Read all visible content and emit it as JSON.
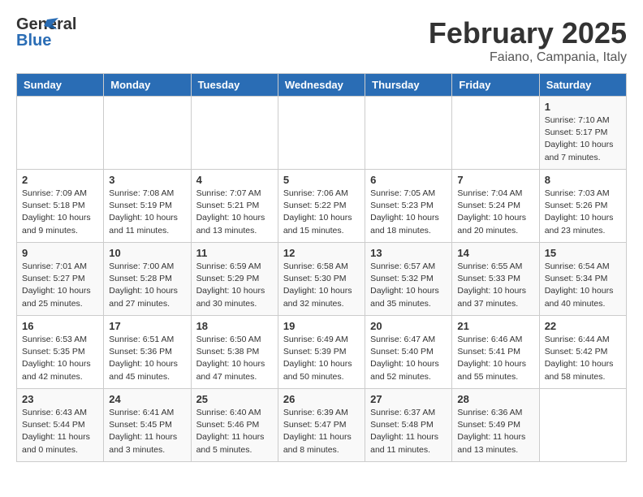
{
  "logo": {
    "line1": "General",
    "line2": "Blue"
  },
  "title": "February 2025",
  "location": "Faiano, Campania, Italy",
  "days_of_week": [
    "Sunday",
    "Monday",
    "Tuesday",
    "Wednesday",
    "Thursday",
    "Friday",
    "Saturday"
  ],
  "weeks": [
    [
      {
        "day": "",
        "info": ""
      },
      {
        "day": "",
        "info": ""
      },
      {
        "day": "",
        "info": ""
      },
      {
        "day": "",
        "info": ""
      },
      {
        "day": "",
        "info": ""
      },
      {
        "day": "",
        "info": ""
      },
      {
        "day": "1",
        "info": "Sunrise: 7:10 AM\nSunset: 5:17 PM\nDaylight: 10 hours\nand 7 minutes."
      }
    ],
    [
      {
        "day": "2",
        "info": "Sunrise: 7:09 AM\nSunset: 5:18 PM\nDaylight: 10 hours\nand 9 minutes."
      },
      {
        "day": "3",
        "info": "Sunrise: 7:08 AM\nSunset: 5:19 PM\nDaylight: 10 hours\nand 11 minutes."
      },
      {
        "day": "4",
        "info": "Sunrise: 7:07 AM\nSunset: 5:21 PM\nDaylight: 10 hours\nand 13 minutes."
      },
      {
        "day": "5",
        "info": "Sunrise: 7:06 AM\nSunset: 5:22 PM\nDaylight: 10 hours\nand 15 minutes."
      },
      {
        "day": "6",
        "info": "Sunrise: 7:05 AM\nSunset: 5:23 PM\nDaylight: 10 hours\nand 18 minutes."
      },
      {
        "day": "7",
        "info": "Sunrise: 7:04 AM\nSunset: 5:24 PM\nDaylight: 10 hours\nand 20 minutes."
      },
      {
        "day": "8",
        "info": "Sunrise: 7:03 AM\nSunset: 5:26 PM\nDaylight: 10 hours\nand 23 minutes."
      }
    ],
    [
      {
        "day": "9",
        "info": "Sunrise: 7:01 AM\nSunset: 5:27 PM\nDaylight: 10 hours\nand 25 minutes."
      },
      {
        "day": "10",
        "info": "Sunrise: 7:00 AM\nSunset: 5:28 PM\nDaylight: 10 hours\nand 27 minutes."
      },
      {
        "day": "11",
        "info": "Sunrise: 6:59 AM\nSunset: 5:29 PM\nDaylight: 10 hours\nand 30 minutes."
      },
      {
        "day": "12",
        "info": "Sunrise: 6:58 AM\nSunset: 5:30 PM\nDaylight: 10 hours\nand 32 minutes."
      },
      {
        "day": "13",
        "info": "Sunrise: 6:57 AM\nSunset: 5:32 PM\nDaylight: 10 hours\nand 35 minutes."
      },
      {
        "day": "14",
        "info": "Sunrise: 6:55 AM\nSunset: 5:33 PM\nDaylight: 10 hours\nand 37 minutes."
      },
      {
        "day": "15",
        "info": "Sunrise: 6:54 AM\nSunset: 5:34 PM\nDaylight: 10 hours\nand 40 minutes."
      }
    ],
    [
      {
        "day": "16",
        "info": "Sunrise: 6:53 AM\nSunset: 5:35 PM\nDaylight: 10 hours\nand 42 minutes."
      },
      {
        "day": "17",
        "info": "Sunrise: 6:51 AM\nSunset: 5:36 PM\nDaylight: 10 hours\nand 45 minutes."
      },
      {
        "day": "18",
        "info": "Sunrise: 6:50 AM\nSunset: 5:38 PM\nDaylight: 10 hours\nand 47 minutes."
      },
      {
        "day": "19",
        "info": "Sunrise: 6:49 AM\nSunset: 5:39 PM\nDaylight: 10 hours\nand 50 minutes."
      },
      {
        "day": "20",
        "info": "Sunrise: 6:47 AM\nSunset: 5:40 PM\nDaylight: 10 hours\nand 52 minutes."
      },
      {
        "day": "21",
        "info": "Sunrise: 6:46 AM\nSunset: 5:41 PM\nDaylight: 10 hours\nand 55 minutes."
      },
      {
        "day": "22",
        "info": "Sunrise: 6:44 AM\nSunset: 5:42 PM\nDaylight: 10 hours\nand 58 minutes."
      }
    ],
    [
      {
        "day": "23",
        "info": "Sunrise: 6:43 AM\nSunset: 5:44 PM\nDaylight: 11 hours\nand 0 minutes."
      },
      {
        "day": "24",
        "info": "Sunrise: 6:41 AM\nSunset: 5:45 PM\nDaylight: 11 hours\nand 3 minutes."
      },
      {
        "day": "25",
        "info": "Sunrise: 6:40 AM\nSunset: 5:46 PM\nDaylight: 11 hours\nand 5 minutes."
      },
      {
        "day": "26",
        "info": "Sunrise: 6:39 AM\nSunset: 5:47 PM\nDaylight: 11 hours\nand 8 minutes."
      },
      {
        "day": "27",
        "info": "Sunrise: 6:37 AM\nSunset: 5:48 PM\nDaylight: 11 hours\nand 11 minutes."
      },
      {
        "day": "28",
        "info": "Sunrise: 6:36 AM\nSunset: 5:49 PM\nDaylight: 11 hours\nand 13 minutes."
      },
      {
        "day": "",
        "info": ""
      }
    ]
  ]
}
